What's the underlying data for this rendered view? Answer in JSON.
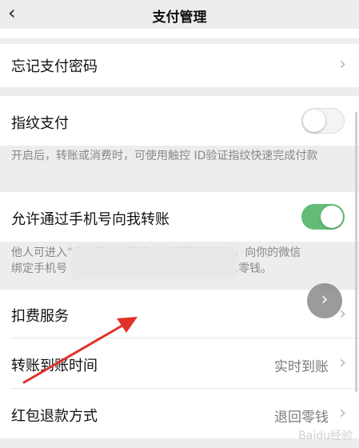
{
  "header": {
    "title": "支付管理",
    "back_icon": "chevron-left-icon"
  },
  "rows": {
    "forgot_password": {
      "label": "忘记支付密码"
    },
    "fingerprint": {
      "label": "指纹支付",
      "enabled": false,
      "description": "开启后，转账或消费时，可使用触控 ID验证指纹快速完成付款"
    },
    "phone_transfer": {
      "label": "允许通过手机号向我转账",
      "enabled": true,
      "description_line1": "他人可进入“收付款→向银行卡或手机号转账”，向你的微信",
      "description_line2_start": "绑定手机号",
      "description_line2_end": "，收款将存入零钱。"
    },
    "deduction_service": {
      "label": "扣费服务"
    },
    "transfer_arrival_time": {
      "label": "转账到账时间",
      "value": "实时到账"
    },
    "red_packet_refund": {
      "label": "红包退款方式",
      "value": "退回零钱"
    }
  },
  "colors": {
    "toggle_on": "#62bc75",
    "arrow": "#e0322a",
    "background": "#ededed"
  },
  "watermark": "Baidu经验"
}
